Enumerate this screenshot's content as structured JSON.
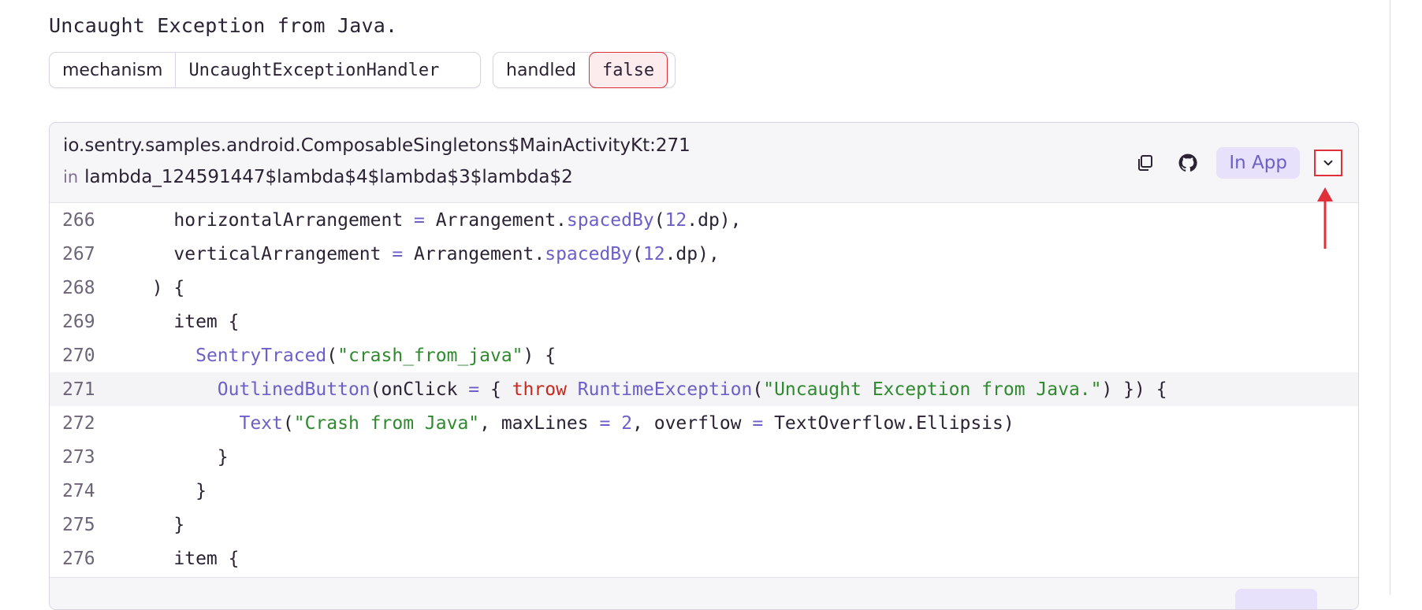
{
  "exception": {
    "message": "Uncaught Exception from Java.",
    "tags": [
      {
        "key": "mechanism",
        "value": "UncaughtExceptionHandler"
      },
      {
        "key": "handled",
        "value": "false"
      }
    ]
  },
  "frame": {
    "location": "io.sentry.samples.android.ComposableSingletons$MainActivityKt:271",
    "in_label": "in",
    "function": "lambda_124591447$lambda$4$lambda$3$lambda$2",
    "badge": "In App",
    "icons": [
      "copy-icon",
      "github-icon",
      "chevron-down-icon"
    ],
    "lines": [
      {
        "no": "266",
        "text": "    horizontalArrangement = Arrangement.spacedBy(12.dp),"
      },
      {
        "no": "267",
        "text": "    verticalArrangement = Arrangement.spacedBy(12.dp),"
      },
      {
        "no": "268",
        "text": "  ) {"
      },
      {
        "no": "269",
        "text": "    item {"
      },
      {
        "no": "270",
        "text": "      SentryTraced(\"crash_from_java\") {"
      },
      {
        "no": "271",
        "text": "        OutlinedButton(onClick = { throw RuntimeException(\"Uncaught Exception from Java.\") }) {"
      },
      {
        "no": "272",
        "text": "          Text(\"Crash from Java\", maxLines = 2, overflow = TextOverflow.Ellipsis)"
      },
      {
        "no": "273",
        "text": "        }"
      },
      {
        "no": "274",
        "text": "      }"
      },
      {
        "no": "275",
        "text": "    }"
      },
      {
        "no": "276",
        "text": "    item {"
      }
    ],
    "highlighted_line": "271"
  },
  "colors": {
    "accent": "#6c5fc7",
    "string": "#2f8a2f",
    "keyword": "#c8281e",
    "highlight_border": "#e0303a"
  }
}
